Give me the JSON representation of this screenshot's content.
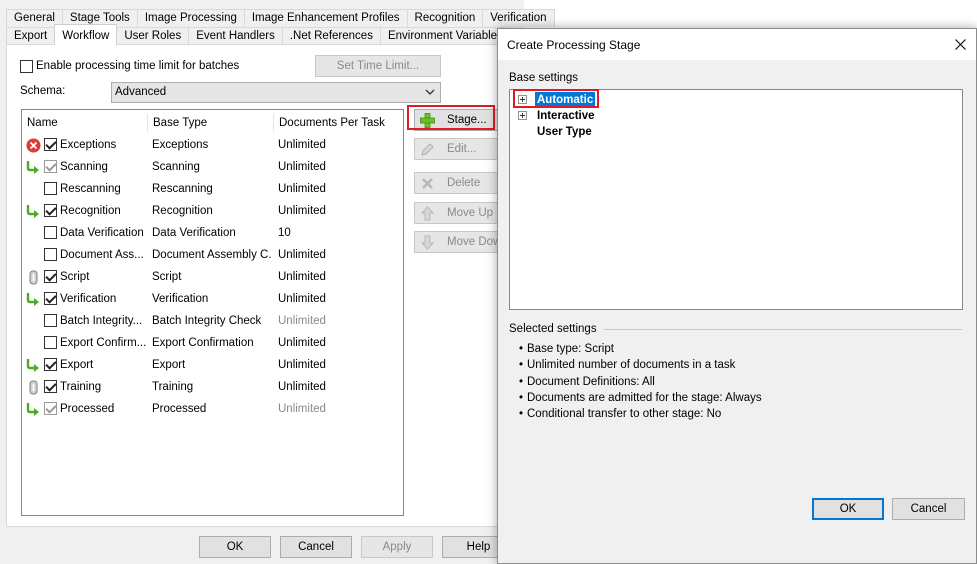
{
  "left_window": {
    "tabs_row1": [
      "General",
      "Stage Tools",
      "Image Processing",
      "Image Enhancement Profiles",
      "Recognition",
      "Verification"
    ],
    "tabs_row2": [
      "Export",
      "Workflow",
      "User Roles",
      "Event Handlers",
      ".Net References",
      "Environment Variable"
    ],
    "active_tab": "Workflow",
    "time_limit_checkbox_label": "Enable processing time limit for batches",
    "time_limit_checked": false,
    "set_time_limit_label": "Set Time Limit...",
    "schema_label": "Schema:",
    "schema_value": "Advanced",
    "columns": [
      "Name",
      "Base Type",
      "Documents Per Task"
    ],
    "stages": [
      {
        "icon": "error-icon",
        "checked": true,
        "dim": false,
        "name": "Exceptions",
        "base_type": "Exceptions",
        "docs": "Unlimited",
        "docs_dim": false
      },
      {
        "icon": "arrow-icon",
        "checked": true,
        "dim": true,
        "name": "Scanning",
        "base_type": "Scanning",
        "docs": "Unlimited",
        "docs_dim": false
      },
      {
        "icon": "",
        "checked": false,
        "dim": false,
        "name": "Rescanning",
        "base_type": "Rescanning",
        "docs": "Unlimited",
        "docs_dim": false
      },
      {
        "icon": "arrow-icon",
        "checked": true,
        "dim": false,
        "name": "Recognition",
        "base_type": "Recognition",
        "docs": "Unlimited",
        "docs_dim": false
      },
      {
        "icon": "",
        "checked": false,
        "dim": false,
        "name": "Data Verification",
        "base_type": "Data Verification",
        "docs": "10",
        "docs_dim": false
      },
      {
        "icon": "",
        "checked": false,
        "dim": false,
        "name": "Document Ass...",
        "base_type": "Document Assembly C...",
        "docs": "Unlimited",
        "docs_dim": false
      },
      {
        "icon": "script-icon",
        "checked": true,
        "dim": false,
        "name": "Script",
        "base_type": "Script",
        "docs": "Unlimited",
        "docs_dim": false
      },
      {
        "icon": "arrow-icon",
        "checked": true,
        "dim": false,
        "name": "Verification",
        "base_type": "Verification",
        "docs": "Unlimited",
        "docs_dim": false
      },
      {
        "icon": "",
        "checked": false,
        "dim": false,
        "name": "Batch Integrity...",
        "base_type": "Batch Integrity Check",
        "docs": "Unlimited",
        "docs_dim": true
      },
      {
        "icon": "",
        "checked": false,
        "dim": false,
        "name": "Export Confirm...",
        "base_type": "Export Confirmation",
        "docs": "Unlimited",
        "docs_dim": false
      },
      {
        "icon": "arrow-icon",
        "checked": true,
        "dim": false,
        "name": "Export",
        "base_type": "Export",
        "docs": "Unlimited",
        "docs_dim": false
      },
      {
        "icon": "script-icon",
        "checked": true,
        "dim": false,
        "name": "Training",
        "base_type": "Training",
        "docs": "Unlimited",
        "docs_dim": false
      },
      {
        "icon": "arrow-icon",
        "checked": true,
        "dim": true,
        "name": "Processed",
        "base_type": "Processed",
        "docs": "Unlimited",
        "docs_dim": true
      }
    ],
    "side_buttons": {
      "stage": "Stage...",
      "edit": "Edit...",
      "delete": "Delete",
      "move_up": "Move Up",
      "move_down": "Move Down"
    },
    "bottom_buttons": {
      "ok": "OK",
      "cancel": "Cancel",
      "apply": "Apply",
      "help": "Help"
    }
  },
  "dialog": {
    "title": "Create Processing Stage",
    "base_settings_label": "Base settings",
    "tree_items": [
      {
        "label": "Automatic",
        "expandable": true,
        "selected": true
      },
      {
        "label": "Interactive",
        "expandable": true,
        "selected": false
      },
      {
        "label": "User Type",
        "expandable": false,
        "selected": false
      }
    ],
    "selected_settings_label": "Selected settings",
    "settings": [
      "Base type: Script",
      "Unlimited number of documents in a task",
      "Document Definitions: All",
      "Documents are admitted for the stage: Always",
      "Conditional transfer to other stage: No"
    ],
    "ok_label": "OK",
    "cancel_label": "Cancel"
  },
  "colors": {
    "highlight": "#e01b24",
    "selection": "#0078d7",
    "add_icon": "#6cbf2a",
    "arrow_icon": "#4fa82b",
    "error_icon": "#d93a3a"
  }
}
